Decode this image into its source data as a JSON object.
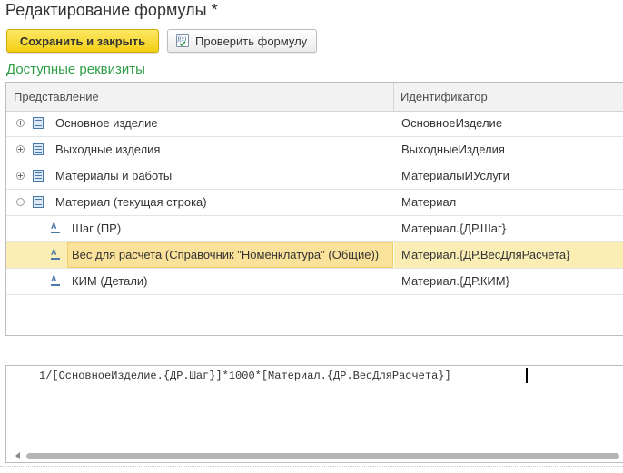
{
  "window": {
    "title": "Редактирование формулы *"
  },
  "toolbar": {
    "save_label": "Сохранить и закрыть",
    "check_label": "Проверить формулу",
    "check_icon": "fx-icon"
  },
  "section": {
    "title": "Доступные реквизиты"
  },
  "table": {
    "columns": [
      "Представление",
      "Идентификатор"
    ],
    "rows": [
      {
        "name": "Основное изделие",
        "id": "ОсновноеИзделие",
        "level": 0,
        "expander": "plus",
        "icon": "table-icon"
      },
      {
        "name": "Выходные изделия",
        "id": "ВыходныеИзделия",
        "level": 0,
        "expander": "plus",
        "icon": "table-icon"
      },
      {
        "name": "Материалы и работы",
        "id": "МатериалыИУслуги",
        "level": 0,
        "expander": "plus",
        "icon": "table-icon"
      },
      {
        "name": "Материал (текущая строка)",
        "id": "Материал",
        "level": 0,
        "expander": "minus",
        "icon": "table-icon"
      },
      {
        "name": "Шаг (ПР)",
        "id": "Материал.{ДР.Шаг}",
        "level": 1,
        "expander": "",
        "icon": "attribute-icon"
      },
      {
        "name": "Вес для расчета (Справочник \"Номенклатура\" (Общие))",
        "id": "Материал.{ДР.ВесДляРасчета}",
        "level": 1,
        "expander": "",
        "icon": "attribute-icon",
        "selected": true
      },
      {
        "name": "КИМ (Детали)",
        "id": "Материал.{ДР.КИМ}",
        "level": 1,
        "expander": "",
        "icon": "attribute-icon"
      }
    ]
  },
  "editor": {
    "formula": "1/[ОсновноеИзделие.{ДР.Шаг}]*1000*[Материал.{ДР.ВесДляРасчета}]"
  },
  "colors": {
    "accent_green": "#2e9e46",
    "primary_button": "#f3cf13",
    "selection": "#fbeeb5"
  }
}
